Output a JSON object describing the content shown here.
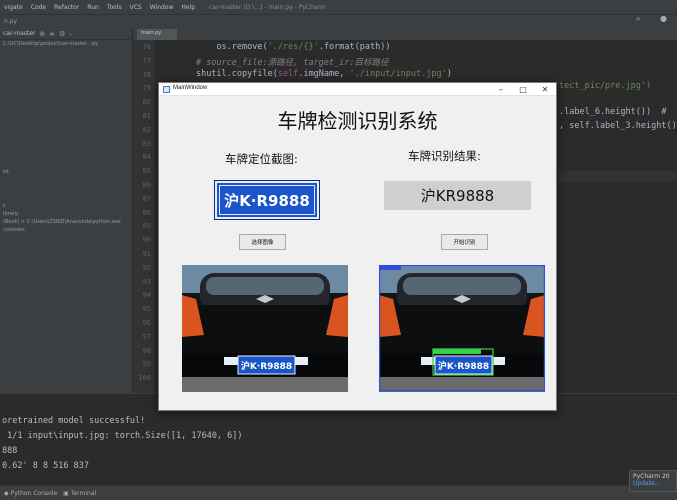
{
  "ide": {
    "menu": [
      "vigate",
      "Code",
      "Refactor",
      "Run",
      "Tools",
      "VCS",
      "Window",
      "Help"
    ],
    "window_title": "car-master [D:\\...] - main.py - PyCharm",
    "nav_path": "n.py",
    "project": {
      "root": "car-master",
      "root_path": "C:\\UC\\Desktop\\project\\car-master - py",
      "rows": [
        "ist",
        "s",
        "Ibrary:",
        "(Book) > C:\\Users\\ZSNZI\\Anaconda\\python.exe",
        "consoles"
      ]
    },
    "tab_label": "main.py",
    "line_numbers": [
      "76",
      "77",
      "78",
      "79",
      "80",
      "81",
      "82",
      "83",
      "84",
      "85",
      "86",
      "87",
      "88",
      "89",
      "90",
      "91",
      "92",
      "93",
      "94",
      "95",
      "96",
      "97",
      "98",
      "99",
      "100"
    ],
    "code_lines": [
      {
        "indent": "            ",
        "parts": [
          {
            "t": "os.remove(",
            "c": "fn"
          },
          {
            "t": "'./res/{}'",
            "c": "str"
          },
          {
            "t": ".format(path))",
            "c": "fn"
          }
        ]
      },
      {
        "indent": "        ",
        "parts": [
          {
            "t": "# source_file:源路径, target_ir:目标路径",
            "c": "cm"
          }
        ]
      },
      {
        "indent": "        ",
        "parts": [
          {
            "t": "shutil.copyfile(",
            "c": "fn"
          },
          {
            "t": "self",
            "c": "slf"
          },
          {
            "t": ".imgName, ",
            "c": "fn"
          },
          {
            "t": "'./input/input.jpg'",
            "c": "str"
          },
          {
            "t": ")",
            "c": "fn"
          }
        ]
      }
    ],
    "code_right": [
      {
        "text": "tect_pic/pre.jpg')",
        "c": "str"
      },
      {
        "text": ".label_6.height())  #",
        "c": "fn"
      },
      {
        "text": ", self.label_3.height()",
        "c": "fn"
      }
    ],
    "console_lines": [
      "oretrained model successful!",
      " 1/1 input\\input.jpg: torch.Size([1, 17640, 6])",
      "888",
      "0.62' 8 8 516 837"
    ],
    "statusbar": [
      "Python Console",
      "Terminal"
    ],
    "notification": {
      "title": "PyCharm 20",
      "link": "Update..."
    }
  },
  "app": {
    "window_title": "MainWindow",
    "title": "车牌检测识别系统",
    "left_label": "车牌定位截图:",
    "right_label": "车牌识别结果:",
    "plate_text": "沪K·R9888",
    "result_text": "沪KR9888",
    "btn_select": "选择图像",
    "btn_start": "开始识别",
    "photo_plate_text": "沪K·R9888"
  },
  "colors": {
    "plate_blue": "#1a55c9",
    "detect_box": "#2f4fd8",
    "plate_box": "#38d14a"
  }
}
